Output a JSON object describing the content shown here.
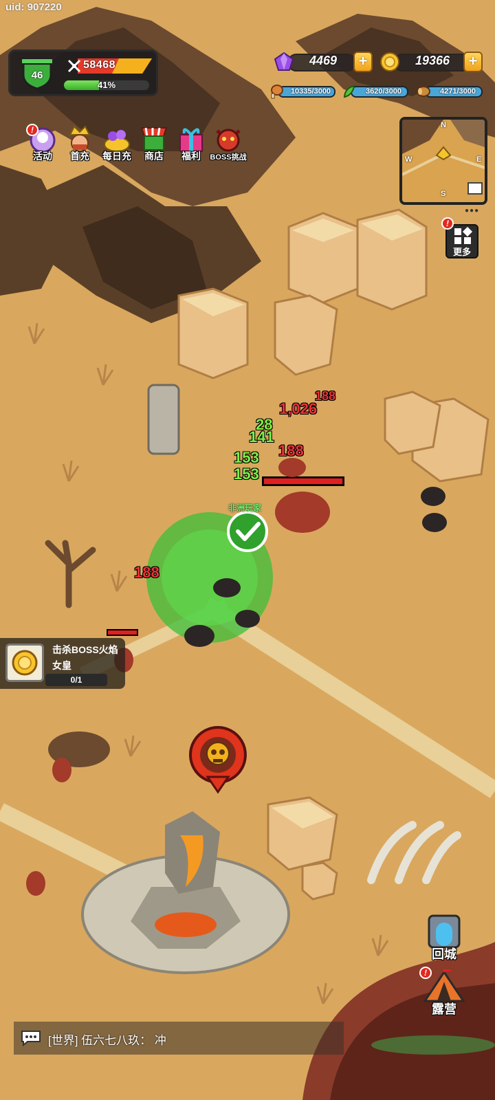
{
  "uid_label": "uid: 907220",
  "player": {
    "level": "46",
    "power": "58468",
    "exp_label": "41%",
    "exp_fraction": 0.41
  },
  "currency": {
    "gems": "4469",
    "gold": "19366"
  },
  "resources": {
    "meat": {
      "label": "10335/3000",
      "fraction": 1.0
    },
    "herb": {
      "label": "3620/3000",
      "fraction": 1.0
    },
    "wood": {
      "label": "4271/3000",
      "fraction": 1.0
    }
  },
  "menu": {
    "activity": "活动",
    "first_recharge": "首充",
    "daily_recharge": "每日充",
    "shop": "商店",
    "welfare": "福利",
    "boss": "BOSS挑战"
  },
  "minimap": {
    "n": "N",
    "s": "S",
    "w": "W",
    "e": "E",
    "dots": "●●●"
  },
  "more_label": "更多",
  "quest": {
    "title": "击杀BOSS火焰女皇",
    "progress": "0/1"
  },
  "side": {
    "return_city": "回城",
    "camp": "露营"
  },
  "chat": {
    "message": "[世界] 伍六七八玖： 冲"
  },
  "notif_mark": "!",
  "combat": {
    "dmg_1": "1,026",
    "dmg_2": "188",
    "dmg_3": "188",
    "dmg_4": "188",
    "heal_1": "28",
    "heal_2": "141",
    "heal_3": "153",
    "heal_4": "153",
    "name_tag": "非洲玩家"
  },
  "colors": {
    "ground": "#d9a85e",
    "panel_dark": "#2b2b2b",
    "exp_green": "#4cc23a",
    "gold_accent": "#f2a21a",
    "damage_red": "#e8333a",
    "heal_green": "#7cf04a"
  }
}
